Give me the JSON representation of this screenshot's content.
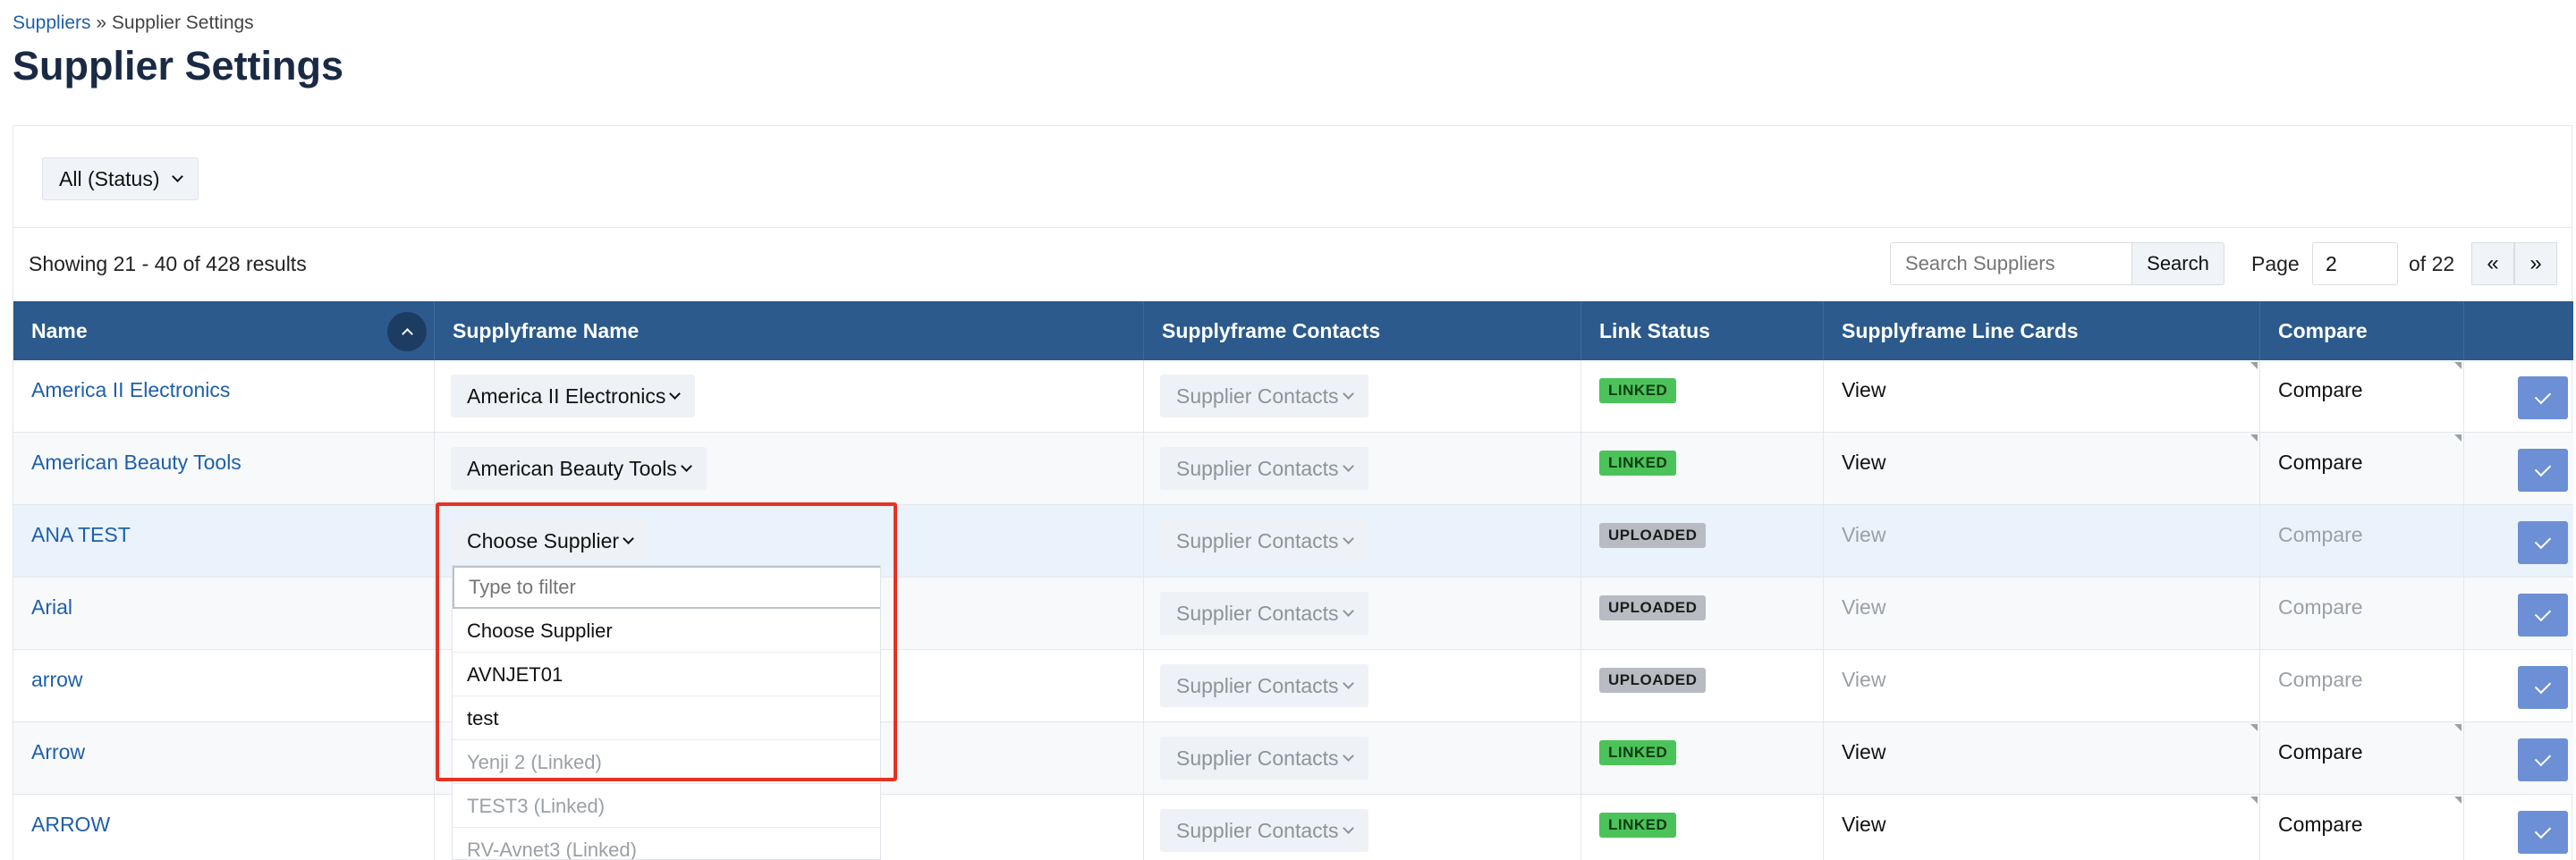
{
  "breadcrumb": {
    "link": "Suppliers",
    "separator": " » ",
    "current": "Supplier Settings"
  },
  "page_title": "Supplier Settings",
  "filter": {
    "status_label": "All (Status)"
  },
  "results_text": "Showing 21 - 40 of 428 results",
  "search": {
    "placeholder": "Search Suppliers",
    "button_label": "Search"
  },
  "pagination": {
    "page_label": "Page",
    "current_page": "2",
    "of_label": "of 22",
    "prev_label": "«",
    "next_label": "»"
  },
  "columns": [
    "Name",
    "Supplyframe Name",
    "Supplyframe Contacts",
    "Link Status",
    "Supplyframe Line Cards",
    "Compare",
    ""
  ],
  "rows": [
    {
      "name": "America II Electronics",
      "sf_name": "America II Electronics",
      "contacts": "Supplier Contacts",
      "status": "LINKED",
      "line_cards": "View",
      "compare": "Compare"
    },
    {
      "name": "American Beauty Tools",
      "sf_name": "American Beauty Tools",
      "contacts": "Supplier Contacts",
      "status": "LINKED",
      "line_cards": "View",
      "compare": "Compare"
    },
    {
      "name": "ANA TEST",
      "sf_name": "Choose Supplier",
      "contacts": "Supplier Contacts",
      "status": "UPLOADED",
      "line_cards": "View",
      "compare": "Compare"
    },
    {
      "name": "Arial",
      "sf_name": "",
      "contacts": "Supplier Contacts",
      "status": "UPLOADED",
      "line_cards": "View",
      "compare": "Compare"
    },
    {
      "name": "arrow",
      "sf_name": "",
      "contacts": "Supplier Contacts",
      "status": "UPLOADED",
      "line_cards": "View",
      "compare": "Compare"
    },
    {
      "name": "Arrow",
      "sf_name": "",
      "contacts": "Supplier Contacts",
      "status": "LINKED",
      "line_cards": "View",
      "compare": "Compare"
    },
    {
      "name": "ARROW",
      "sf_name": "",
      "contacts": "Supplier Contacts",
      "status": "LINKED",
      "line_cards": "View",
      "compare": "Compare"
    }
  ],
  "dropdown": {
    "filter_placeholder": "Type to filter",
    "options": [
      "Choose Supplier",
      "AVNJET01",
      "test",
      "Yenji 2 (Linked)",
      "TEST3 (Linked)",
      "RV-Avnet3 (Linked)"
    ]
  },
  "colors": {
    "header_bg": "#2c5a8c",
    "link": "#1f5fa8",
    "linked": "#4cc35a",
    "uploaded": "#b8bcc2",
    "highlight_box": "#e53224",
    "confirm_button": "#6c8fd6"
  },
  "icons": [
    "chevron-down-icon",
    "chevron-up-icon",
    "check-icon"
  ]
}
